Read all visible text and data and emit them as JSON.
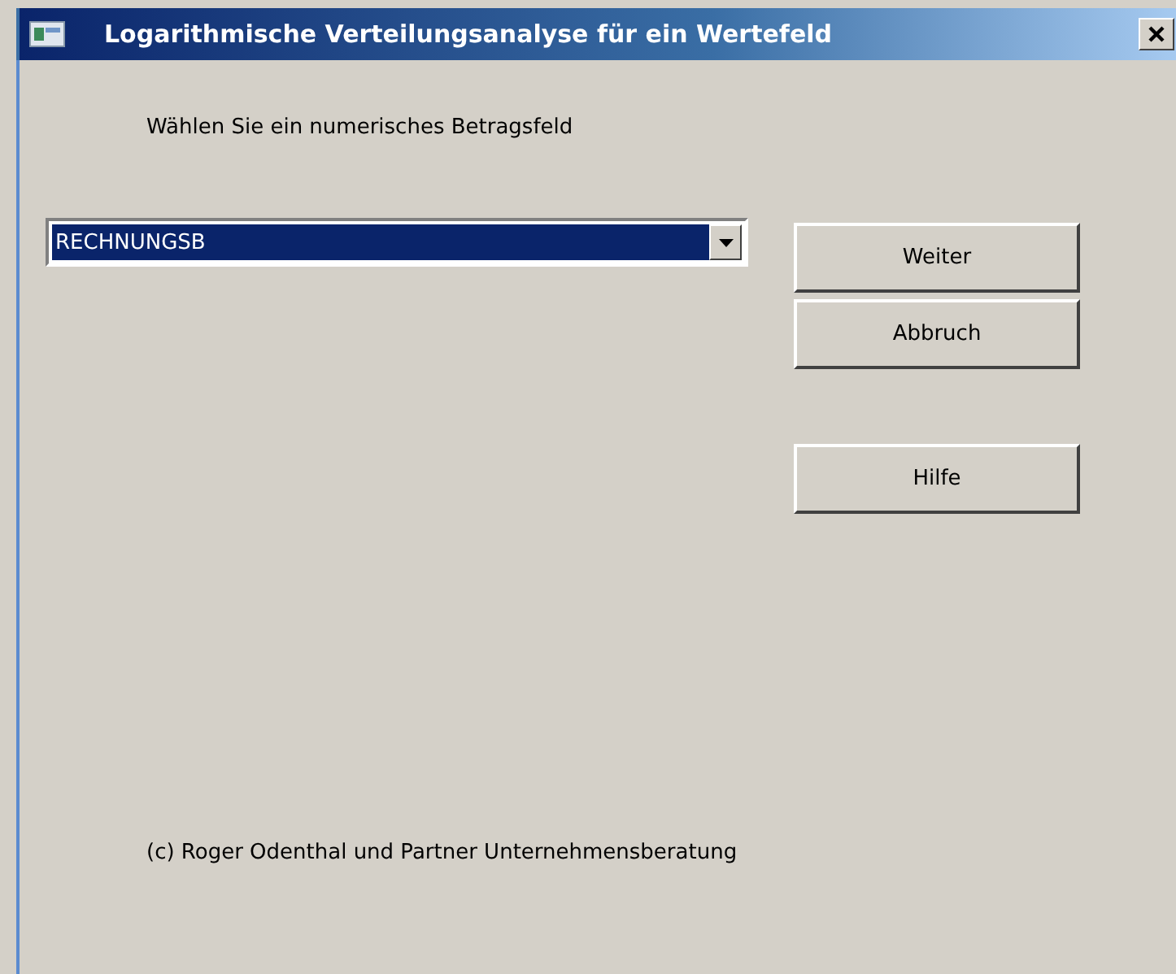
{
  "window": {
    "title": "Logarithmische Verteilungsanalyse für ein Wertefeld"
  },
  "prompt": "Wählen Sie ein numerisches Betragsfeld",
  "field_select": {
    "value": "RECHNUNGSB",
    "selected": true
  },
  "buttons": [
    {
      "label": "Weiter"
    },
    {
      "label": "Abbruch"
    },
    {
      "label": "Hilfe",
      "kind": "spaced"
    }
  ],
  "footer": "(c) Roger Odenthal und Partner Unternehmensberatung"
}
